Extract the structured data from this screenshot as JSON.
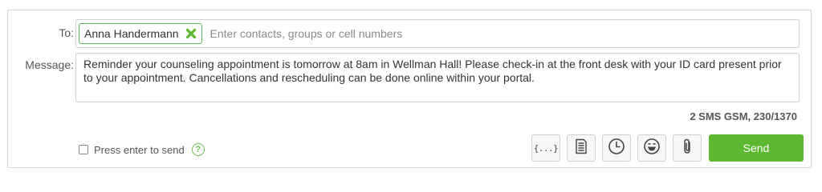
{
  "labels": {
    "to": "To:",
    "message": "Message:"
  },
  "recipients": [
    {
      "name": "Anna Handermann",
      "remove_icon": "green-x-icon"
    }
  ],
  "to_input": {
    "placeholder": "Enter contacts, groups or cell numbers",
    "value": ""
  },
  "message": {
    "text": "Reminder your counseling appointment is tomorrow at 8am in Wellman Hall! Please check-in at the front desk with your ID card present prior to your appointment. Cancellations and rescheduling can be done online within your portal."
  },
  "counter": "2 SMS GSM, 230/1370",
  "enter_to_send": {
    "label": "Press enter to send",
    "checked": false,
    "help_icon": "question-circle-icon",
    "help_glyph": "?"
  },
  "toolbar": {
    "insert_variable_glyph": "{...}",
    "buttons": [
      {
        "icon": "insert-variable-icon"
      },
      {
        "icon": "template-document-icon"
      },
      {
        "icon": "schedule-clock-icon"
      },
      {
        "icon": "emoji-icon"
      },
      {
        "icon": "attachment-paperclip-icon"
      }
    ],
    "send_label": "Send"
  },
  "colors": {
    "accent_green": "#5cb82f",
    "chip_border": "#5cb85c",
    "border": "#cfcfcf"
  }
}
